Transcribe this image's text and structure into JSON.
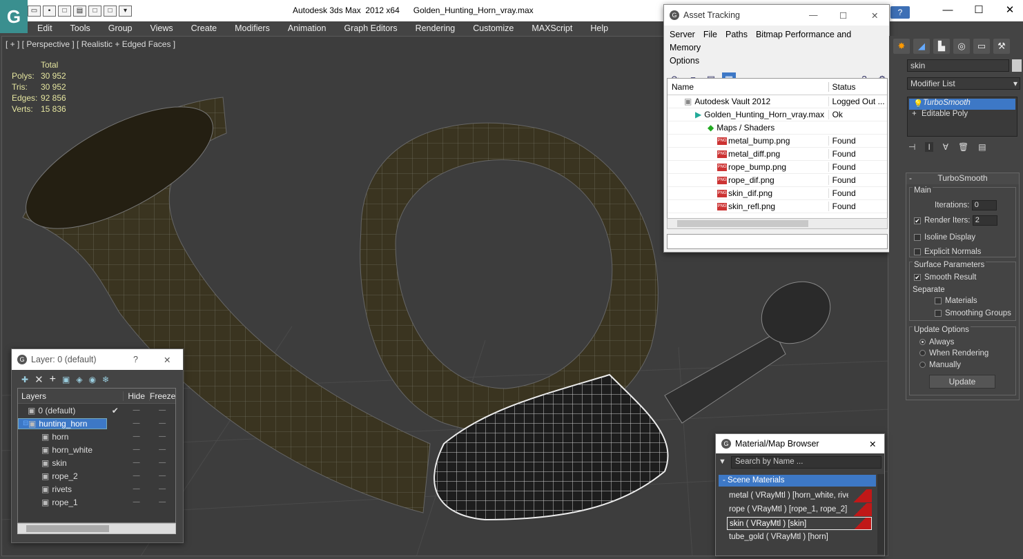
{
  "app": {
    "logo_glyph": "G",
    "title": "Autodesk 3ds Max  2012 x64      Golden_Hunting_Horn_vray.max",
    "help_label": "?",
    "min_glyph": "—",
    "max_glyph": "☐",
    "close_glyph": "✕"
  },
  "menubar": [
    "Edit",
    "Tools",
    "Group",
    "Views",
    "Create",
    "Modifiers",
    "Animation",
    "Graph Editors",
    "Rendering",
    "Customize",
    "MAXScript",
    "Help"
  ],
  "viewport": {
    "label": "[ + ] [ Perspective ] [ Realistic + Edged Faces ]",
    "stats_header": "Total",
    "stats": [
      {
        "key": "Polys:",
        "value": "30 952"
      },
      {
        "key": "Tris:",
        "value": "30 952"
      },
      {
        "key": "Edges:",
        "value": "92 856"
      },
      {
        "key": "Verts:",
        "value": "15 836"
      }
    ]
  },
  "asset_tracking": {
    "title": "Asset Tracking",
    "menu": [
      "Server",
      "File",
      "Paths",
      "Bitmap Performance and Memory",
      "Options"
    ],
    "col_name": "Name",
    "col_status": "Status",
    "rows": [
      {
        "name": "Autodesk Vault 2012",
        "status": "Logged Out ...",
        "indent": 24
      },
      {
        "name": "Golden_Hunting_Horn_vray.max",
        "status": "Ok",
        "indent": 40
      },
      {
        "name": "Maps / Shaders",
        "status": "",
        "indent": 58
      },
      {
        "name": "metal_bump.png",
        "status": "Found",
        "indent": 72
      },
      {
        "name": "metal_diff.png",
        "status": "Found",
        "indent": 72
      },
      {
        "name": "rope_bump.png",
        "status": "Found",
        "indent": 72
      },
      {
        "name": "rope_dif.png",
        "status": "Found",
        "indent": 72
      },
      {
        "name": "skin_dif.png",
        "status": "Found",
        "indent": 72
      },
      {
        "name": "skin_refl.png",
        "status": "Found",
        "indent": 72
      }
    ],
    "png_tag": "PNG"
  },
  "layer_panel": {
    "title": "Layer: 0 (default)",
    "help_glyph": "?",
    "close_glyph": "✕",
    "col_layers": "Layers",
    "col_hide": "Hide",
    "col_freeze": "Freeze",
    "rows": [
      {
        "name": "0 (default)",
        "indent": 14,
        "selected": false,
        "mark": "✔"
      },
      {
        "name": "hunting_horn",
        "indent": 14,
        "selected": true,
        "mark": ""
      },
      {
        "name": "horn",
        "indent": 34,
        "selected": false,
        "mark": ""
      },
      {
        "name": "horn_white",
        "indent": 34,
        "selected": false,
        "mark": ""
      },
      {
        "name": "skin",
        "indent": 34,
        "selected": false,
        "mark": ""
      },
      {
        "name": "rope_2",
        "indent": 34,
        "selected": false,
        "mark": ""
      },
      {
        "name": "rivets",
        "indent": 34,
        "selected": false,
        "mark": ""
      },
      {
        "name": "rope_1",
        "indent": 34,
        "selected": false,
        "mark": ""
      }
    ],
    "dash": "—"
  },
  "command_panel": {
    "object_name": "skin",
    "modifier_list": "Modifier List",
    "stack": [
      "TurboSmooth",
      "Editable Poly"
    ],
    "rollout_title": "TurboSmooth",
    "main_label": "Main",
    "iterations_label": "Iterations:",
    "iterations_value": "0",
    "render_iters_label": "Render Iters:",
    "render_iters_value": "2",
    "isoline_label": "Isoline Display",
    "explicit_normals_label": "Explicit Normals",
    "surface_params_label": "Surface Parameters",
    "smooth_result_label": "Smooth Result",
    "separate_label": "Separate",
    "materials_label": "Materials",
    "smoothing_groups_label": "Smoothing Groups",
    "update_options_label": "Update Options",
    "always_label": "Always",
    "when_rendering_label": "When Rendering",
    "manually_label": "Manually",
    "update_button": "Update",
    "check_glyph": "✔"
  },
  "material_browser": {
    "title": "Material/Map Browser",
    "search_placeholder": "Search by Name ...",
    "group_label": "- Scene Materials",
    "items": [
      {
        "label": "metal  ( VRayMtl )  [horn_white, rivets]",
        "swatch": true,
        "selected": false
      },
      {
        "label": "rope  ( VRayMtl )  [rope_1, rope_2]",
        "swatch": true,
        "selected": false
      },
      {
        "label": "skin  ( VRayMtl )  [skin]",
        "swatch": true,
        "selected": true
      },
      {
        "label": "tube_gold  ( VRayMtl )  [horn]",
        "swatch": false,
        "selected": false
      }
    ]
  },
  "colors": {
    "accent": "#3d78c6",
    "viewport_bg": "#3d3d3d",
    "wire": "#d8d8d8",
    "horn": "#3a3420"
  }
}
